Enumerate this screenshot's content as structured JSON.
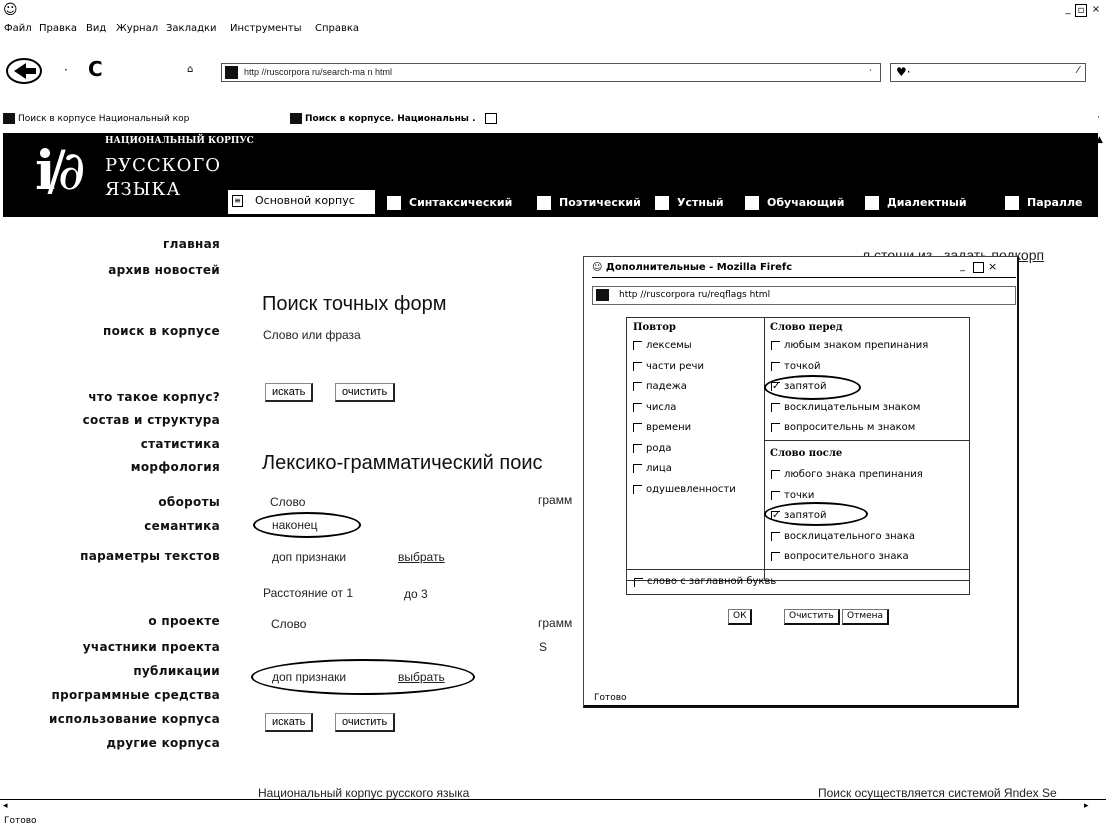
{
  "browser": {
    "menu": [
      "Файл",
      "Правка",
      "Вид",
      "Журнал",
      "Закладки",
      "Инструменты",
      "Справка"
    ],
    "url": "http //ruscorpora ru/search-ma n html",
    "search_icon": "search-engine-icon",
    "bookmarks": [
      "Поиск в корпусе Национальный кор",
      "Поиск в корпусе. Национальны ."
    ],
    "status": "Готово"
  },
  "site": {
    "logo_top": "НАЦИОНАЛЬНЫЙ КОРПУС",
    "logo_line1": "РУССКОГО",
    "logo_line2": "ЯЗЫКА",
    "tabs": [
      "Основной корпус",
      "Синтаксический",
      "Поэтический",
      "Устный",
      "Обучающий",
      "Диалектный",
      "Паралле"
    ],
    "top_right_text": "л стоши из , задать подкорп",
    "footer_left": "Национальный корпус русского языка",
    "footer_right": "Поиск осуществляется системой Яndex Se"
  },
  "nav": {
    "items": [
      "главная",
      "архив новостей",
      "поиск в корпусе",
      "что такое корпус?",
      "состав и структура",
      "статистика",
      "морфология",
      "обороты",
      "семантика",
      "параметры текстов",
      "о проекте",
      "участники проекта",
      "публикации",
      "программные средства",
      "использование корпуса",
      "другие корпуса"
    ]
  },
  "exact": {
    "heading": "Поиск точных форм",
    "label": "Слово или фраза",
    "search_btn": "искать",
    "clear_btn": "очистить"
  },
  "lexgram": {
    "heading": "Лексико-грамматический поис",
    "word1_label": "Слово",
    "gram1_label": "грамм",
    "word1_value": "наконец",
    "extra1_label": "доп признаки",
    "extra1_link": "выбрать",
    "distance_label": "Расстояние  от 1",
    "distance_to": "до 3",
    "word2_label": "Слово",
    "gram2_label": "грамм",
    "s_text": "S",
    "extra2_label": "доп признаки",
    "extra2_link": "выбрать",
    "search_btn": "искать",
    "clear_btn": "очистить"
  },
  "popup": {
    "title": "Дополнительные - Mozilla Firefc",
    "url": "http //ruscorpora ru/reqflags html",
    "repeat_label": "Повтор",
    "repeat_opts": [
      "лексемы",
      "части речи",
      "падежа",
      "числа",
      "времени",
      "рода",
      "лица",
      "одушевленности"
    ],
    "before_label": "Слово перед",
    "before_opts": [
      {
        "label": "любым знаком препинания",
        "checked": false
      },
      {
        "label": "точкой",
        "checked": false
      },
      {
        "label": "запятой",
        "checked": true
      },
      {
        "label": "восклицательным знаком",
        "checked": false
      },
      {
        "label": "вопросительнь м знаком",
        "checked": false
      }
    ],
    "after_label": "Слово после",
    "after_opts": [
      {
        "label": "любого знака препинания",
        "checked": false
      },
      {
        "label": "точки",
        "checked": false
      },
      {
        "label": "запятой",
        "checked": true
      },
      {
        "label": "восклицательного знака",
        "checked": false
      },
      {
        "label": "вопросительного знака",
        "checked": false
      }
    ],
    "capital_label": "слово с заглавной буквь",
    "ok_btn": "ОК",
    "clear_btn": "Очистить",
    "cancel_btn": "Отмена",
    "status": "Готово"
  }
}
